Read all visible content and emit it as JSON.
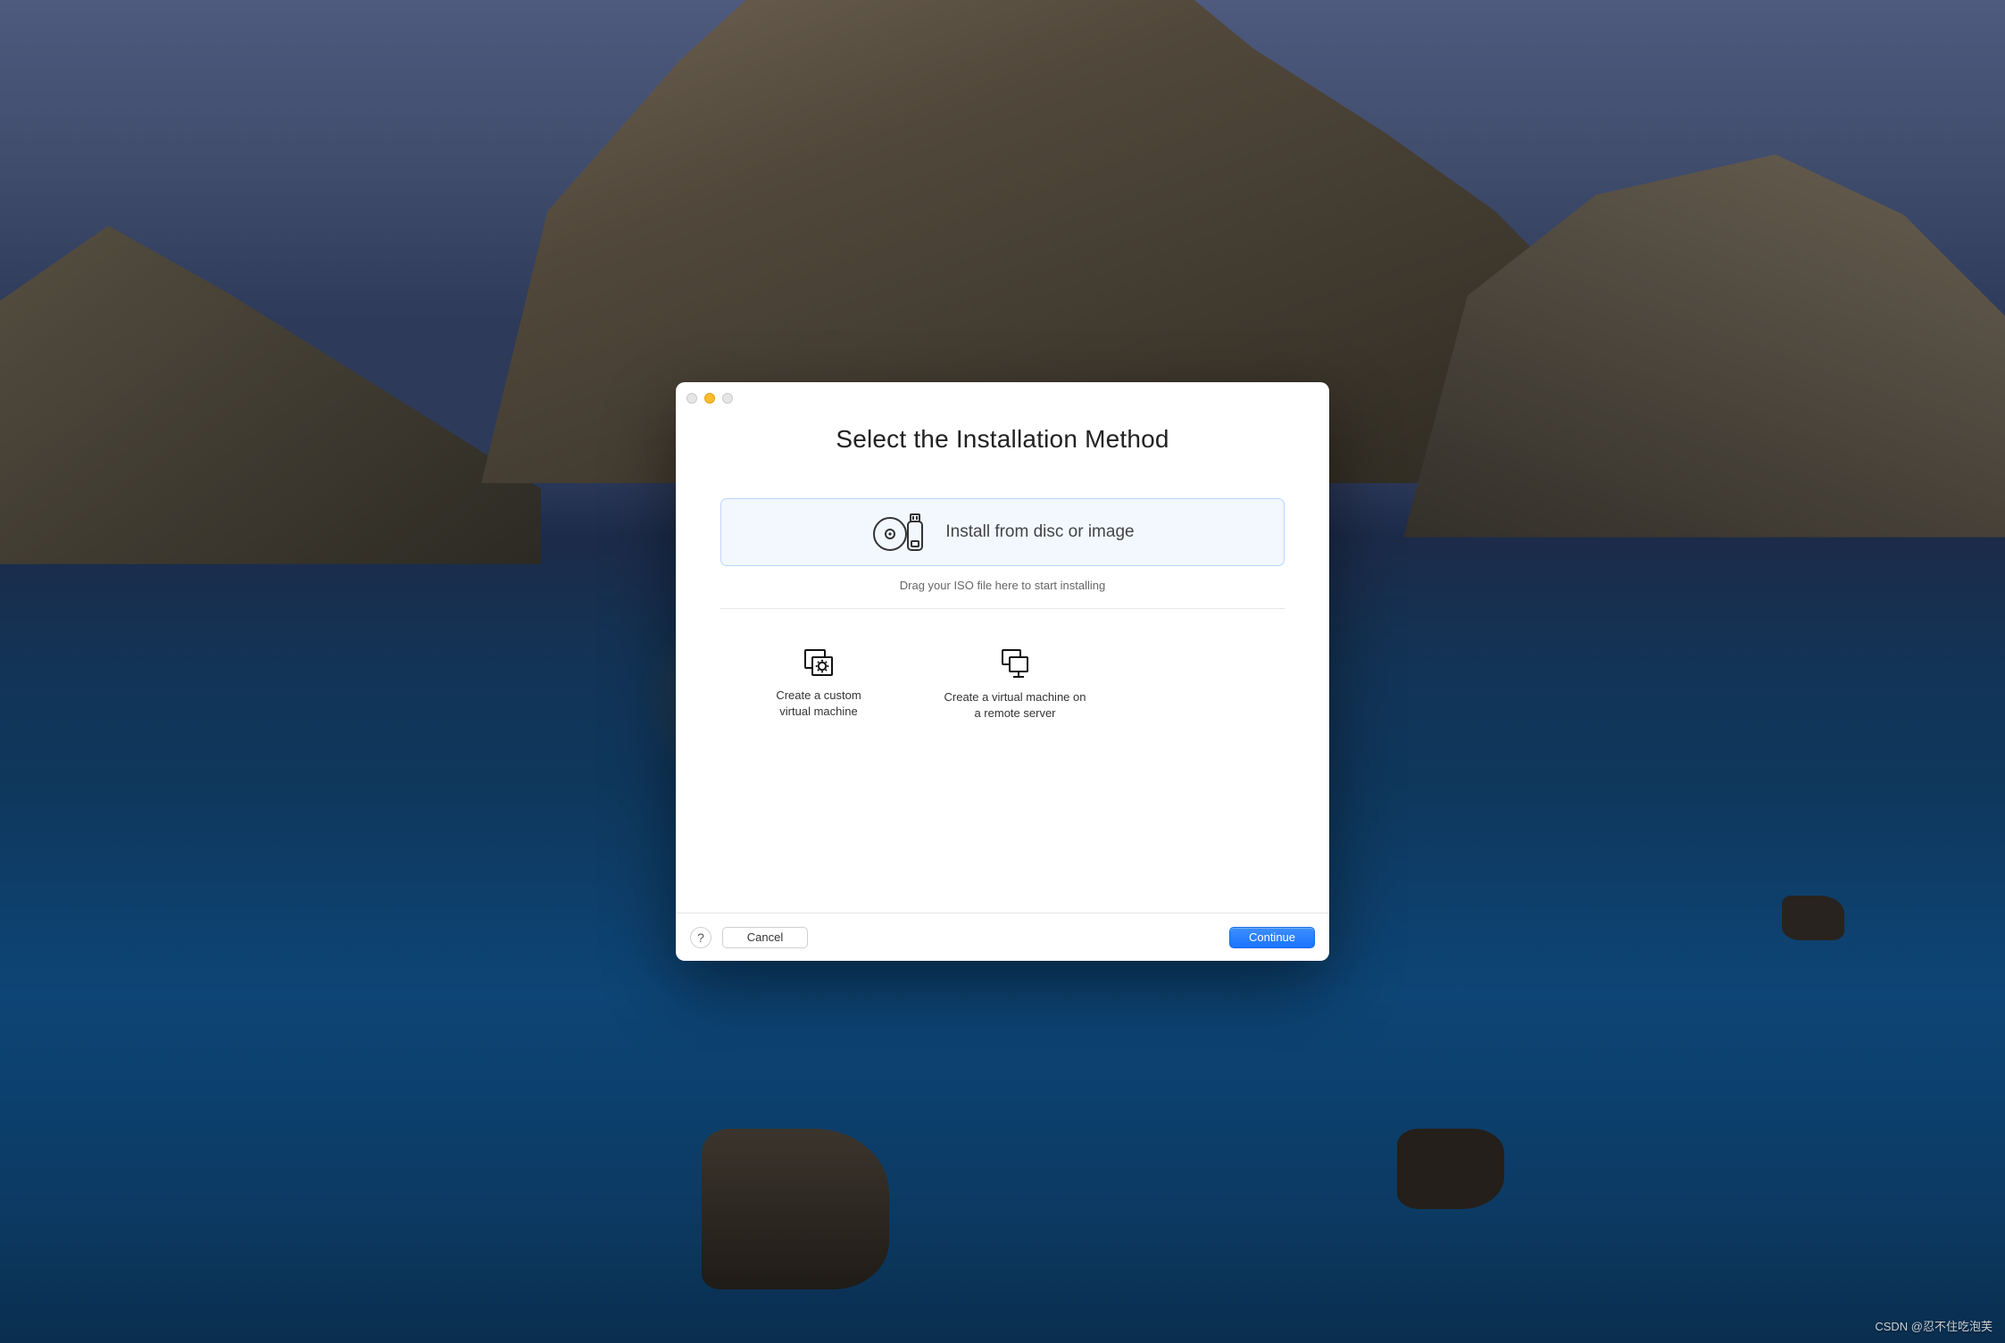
{
  "window": {
    "title": "Select the Installation Method"
  },
  "primary_option": {
    "label": "Install from disc or image",
    "hint": "Drag your ISO file here to start installing",
    "icon": "disc-usb-icon"
  },
  "secondary_options": [
    {
      "icon": "custom-vm-icon",
      "label_line1": "Create a custom",
      "label_line2": "virtual machine"
    },
    {
      "icon": "remote-vm-icon",
      "label_line1": "Create a virtual machine on",
      "label_line2": "a remote server"
    }
  ],
  "footer": {
    "help_label": "?",
    "cancel_label": "Cancel",
    "continue_label": "Continue"
  },
  "watermark": "CSDN @忍不住吃泡芙"
}
